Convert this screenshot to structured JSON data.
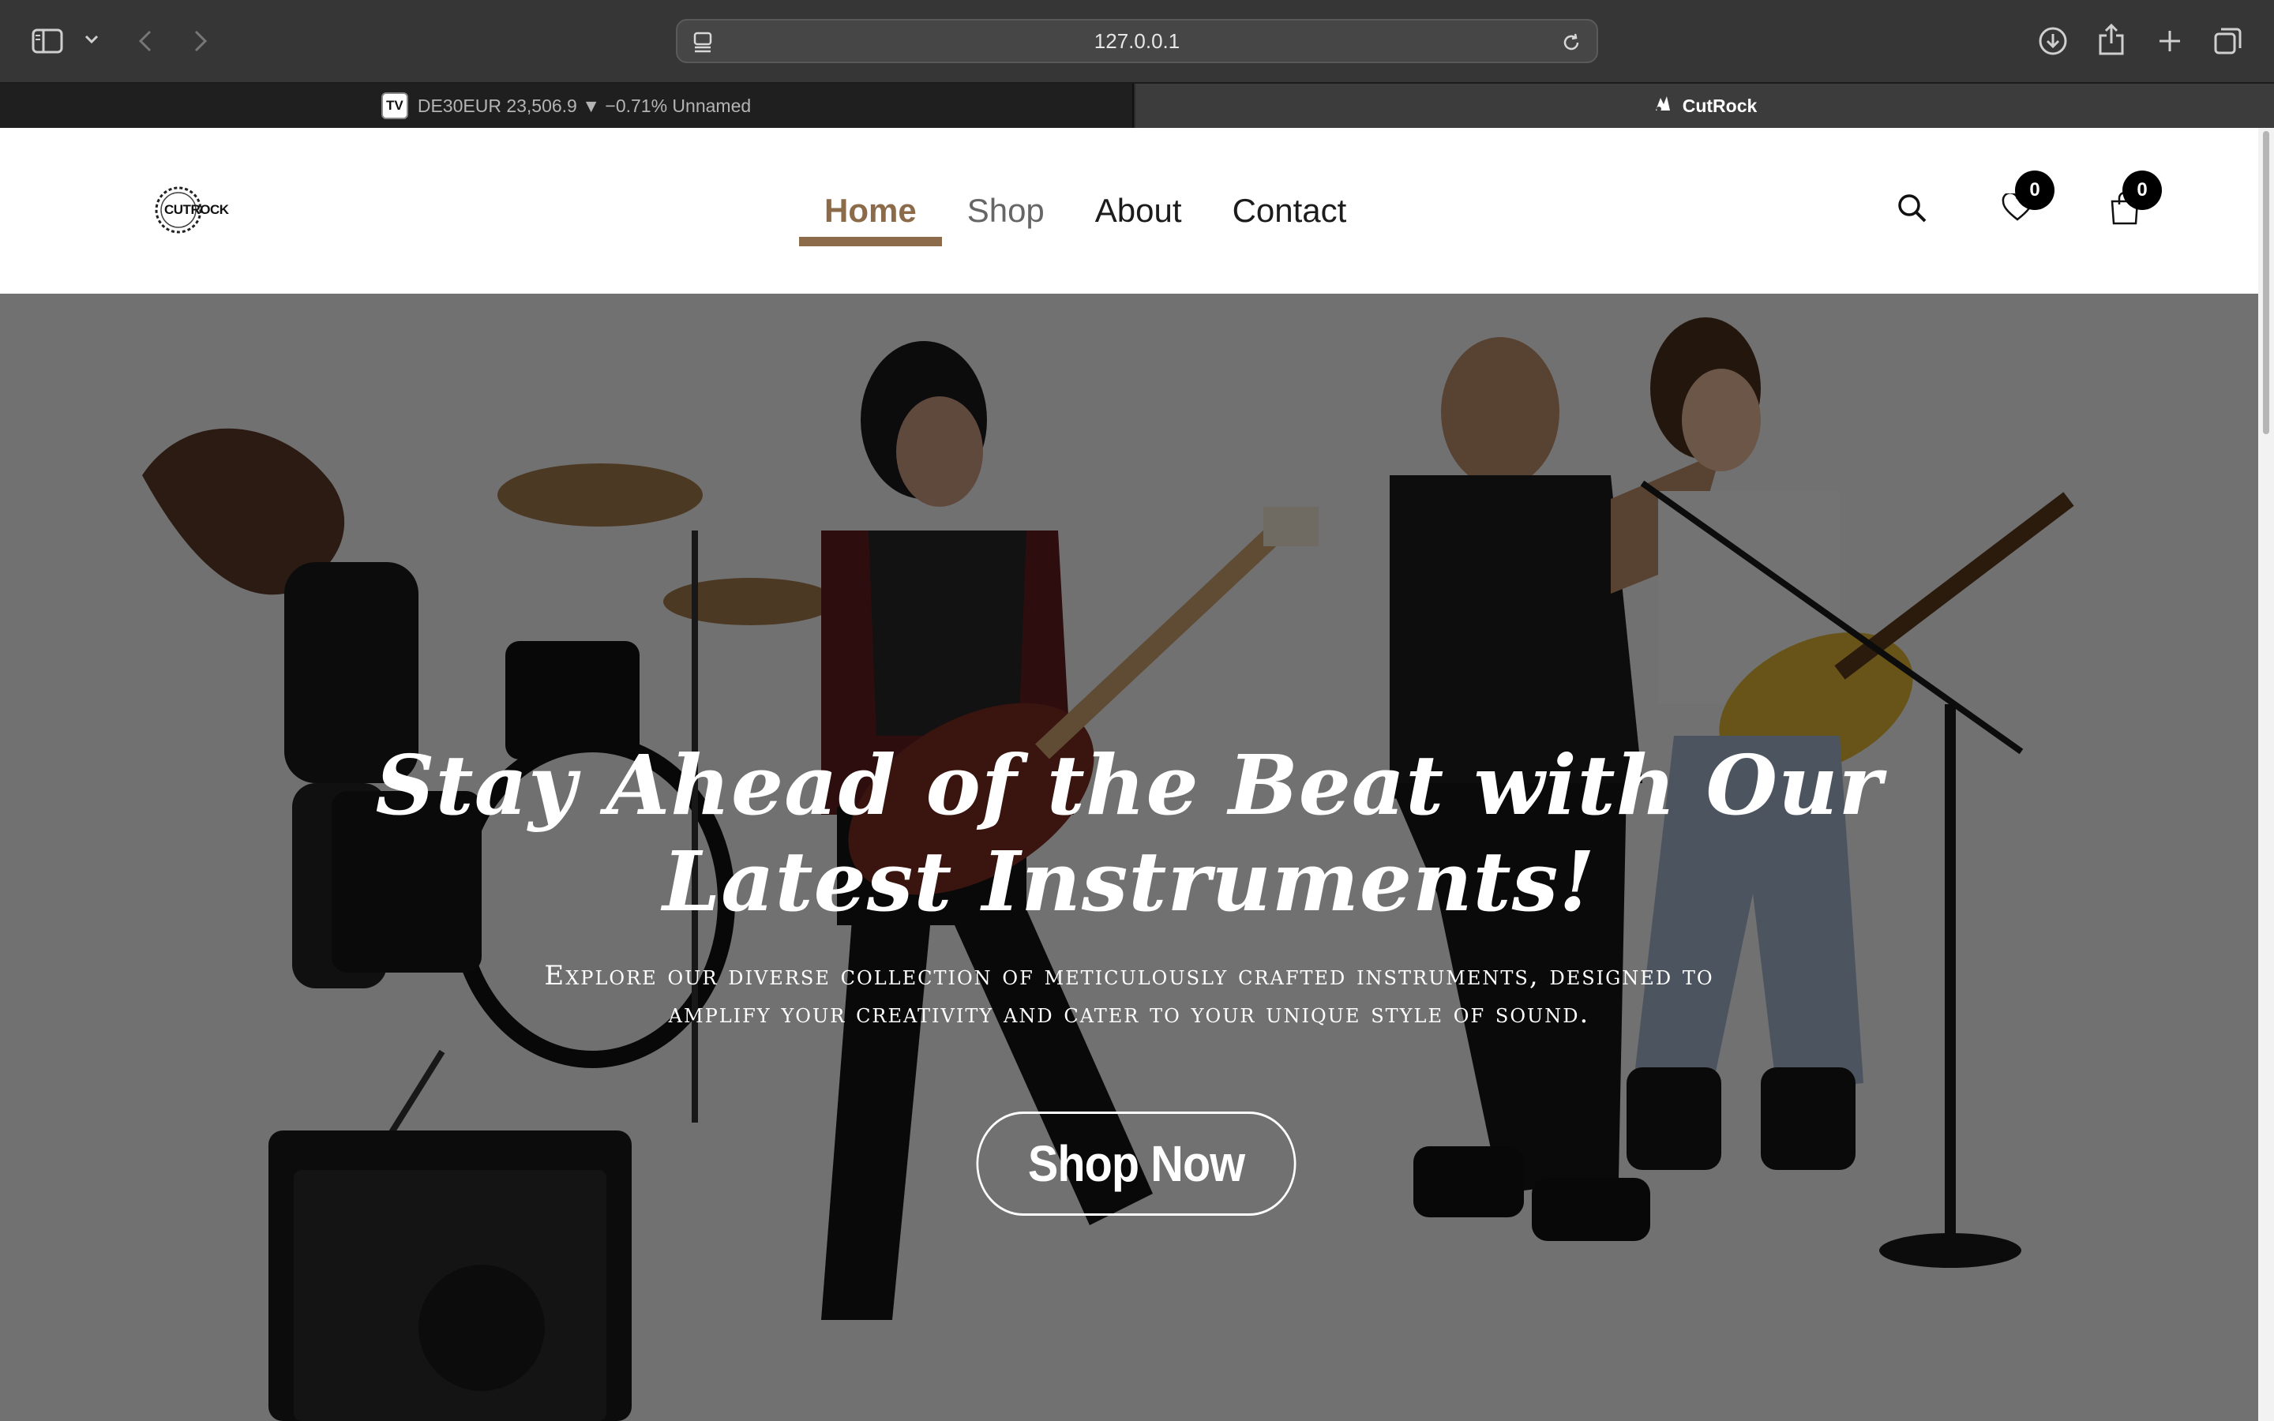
{
  "browser": {
    "url": "127.0.0.1",
    "tabs": [
      {
        "label": "DE30EUR 23,506.9 ▼ −0.71% Unnamed",
        "icon": "tradingview-icon",
        "active": false
      },
      {
        "label": "CutRock",
        "icon": "cutrock-favicon",
        "active": true
      }
    ],
    "toolbar_icons": [
      "sidebar-icon",
      "chevron-down-icon",
      "back-icon",
      "forward-icon",
      "download-icon",
      "share-icon",
      "new-tab-icon",
      "tab-overview-icon"
    ]
  },
  "site": {
    "logo_text": "CUTROCK",
    "nav": [
      {
        "label": "Home",
        "active": true
      },
      {
        "label": "Shop",
        "active": false
      },
      {
        "label": "About",
        "active": false
      },
      {
        "label": "Contact",
        "active": false
      }
    ],
    "wishlist_count": "0",
    "cart_count": "0"
  },
  "hero": {
    "title": "Stay Ahead of the Beat with Our Latest Instruments!",
    "subtitle": "Explore our diverse collection of meticulously crafted instruments, designed to amplify your creativity and cater to your unique style of sound.",
    "cta_label": "Shop Now"
  },
  "colors": {
    "accent": "#8b6b4a",
    "browser_toolbar": "#363636",
    "badge": "#000000"
  }
}
